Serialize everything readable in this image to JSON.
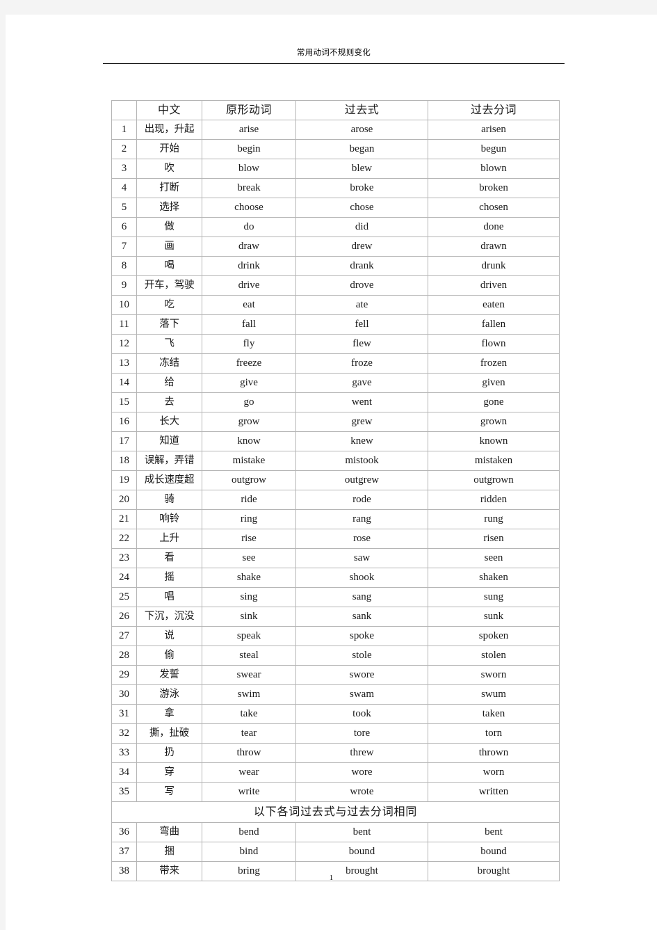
{
  "document": {
    "title": "常用动词不规则变化",
    "page_number": "1"
  },
  "table": {
    "headers": {
      "index": "",
      "chinese": "中文",
      "base": "原形动词",
      "past": "过去式",
      "participle": "过去分词"
    },
    "section_note": "以下各词过去式与过去分词相同",
    "rows": [
      {
        "n": "1",
        "zh": "出现，升起",
        "base": "arise",
        "past": "arose",
        "pp": "arisen"
      },
      {
        "n": "2",
        "zh": "开始",
        "base": "begin",
        "past": "began",
        "pp": "begun"
      },
      {
        "n": "3",
        "zh": "吹",
        "base": "blow",
        "past": "blew",
        "pp": "blown"
      },
      {
        "n": "4",
        "zh": "打断",
        "base": "break",
        "past": "broke",
        "pp": "broken"
      },
      {
        "n": "5",
        "zh": "选择",
        "base": "choose",
        "past": "chose",
        "pp": "chosen"
      },
      {
        "n": "6",
        "zh": "做",
        "base": "do",
        "past": "did",
        "pp": "done"
      },
      {
        "n": "7",
        "zh": "画",
        "base": "draw",
        "past": "drew",
        "pp": "drawn"
      },
      {
        "n": "8",
        "zh": "喝",
        "base": "drink",
        "past": "drank",
        "pp": "drunk"
      },
      {
        "n": "9",
        "zh": "开车，驾驶",
        "base": "drive",
        "past": "drove",
        "pp": "driven"
      },
      {
        "n": "10",
        "zh": "吃",
        "base": "eat",
        "past": "ate",
        "pp": "eaten"
      },
      {
        "n": "11",
        "zh": "落下",
        "base": "fall",
        "past": "fell",
        "pp": "fallen"
      },
      {
        "n": "12",
        "zh": "飞",
        "base": "fly",
        "past": "flew",
        "pp": "flown"
      },
      {
        "n": "13",
        "zh": "冻结",
        "base": "freeze",
        "past": "froze",
        "pp": "frozen"
      },
      {
        "n": "14",
        "zh": "给",
        "base": "give",
        "past": "gave",
        "pp": "given"
      },
      {
        "n": "15",
        "zh": "去",
        "base": "go",
        "past": "went",
        "pp": "gone"
      },
      {
        "n": "16",
        "zh": "长大",
        "base": "grow",
        "past": "grew",
        "pp": "grown"
      },
      {
        "n": "17",
        "zh": "知道",
        "base": "know",
        "past": "knew",
        "pp": "known"
      },
      {
        "n": "18",
        "zh": "误解，弄错",
        "base": "mistake",
        "past": "mistook",
        "pp": "mistaken"
      },
      {
        "n": "19",
        "zh": "成长速度超",
        "base": "outgrow",
        "past": "outgrew",
        "pp": "outgrown"
      },
      {
        "n": "20",
        "zh": "骑",
        "base": "ride",
        "past": "rode",
        "pp": "ridden"
      },
      {
        "n": "21",
        "zh": "响铃",
        "base": "ring",
        "past": "rang",
        "pp": "rung"
      },
      {
        "n": "22",
        "zh": "上升",
        "base": "rise",
        "past": "rose",
        "pp": "risen"
      },
      {
        "n": "23",
        "zh": "看",
        "base": "see",
        "past": "saw",
        "pp": "seen"
      },
      {
        "n": "24",
        "zh": "摇",
        "base": "shake",
        "past": "shook",
        "pp": "shaken"
      },
      {
        "n": "25",
        "zh": "唱",
        "base": "sing",
        "past": "sang",
        "pp": "sung"
      },
      {
        "n": "26",
        "zh": "下沉，沉没",
        "base": "sink",
        "past": "sank",
        "pp": "sunk"
      },
      {
        "n": "27",
        "zh": "说",
        "base": "speak",
        "past": "spoke",
        "pp": "spoken"
      },
      {
        "n": "28",
        "zh": "偷",
        "base": "steal",
        "past": "stole",
        "pp": "stolen"
      },
      {
        "n": "29",
        "zh": "发誓",
        "base": "swear",
        "past": "swore",
        "pp": "sworn"
      },
      {
        "n": "30",
        "zh": "游泳",
        "base": "swim",
        "past": "swam",
        "pp": "swum"
      },
      {
        "n": "31",
        "zh": "拿",
        "base": "take",
        "past": "took",
        "pp": "taken"
      },
      {
        "n": "32",
        "zh": "撕，扯破",
        "base": "tear",
        "past": "tore",
        "pp": "torn"
      },
      {
        "n": "33",
        "zh": "扔",
        "base": "throw",
        "past": "threw",
        "pp": "thrown"
      },
      {
        "n": "34",
        "zh": "穿",
        "base": "wear",
        "past": "wore",
        "pp": "worn"
      },
      {
        "n": "35",
        "zh": "写",
        "base": "write",
        "past": "wrote",
        "pp": "written"
      }
    ],
    "rows_after_note": [
      {
        "n": "36",
        "zh": "弯曲",
        "base": "bend",
        "past": "bent",
        "pp": "bent"
      },
      {
        "n": "37",
        "zh": "捆",
        "base": "bind",
        "past": "bound",
        "pp": "bound"
      },
      {
        "n": "38",
        "zh": "带来",
        "base": "bring",
        "past": "brought",
        "pp": "brought"
      }
    ]
  }
}
